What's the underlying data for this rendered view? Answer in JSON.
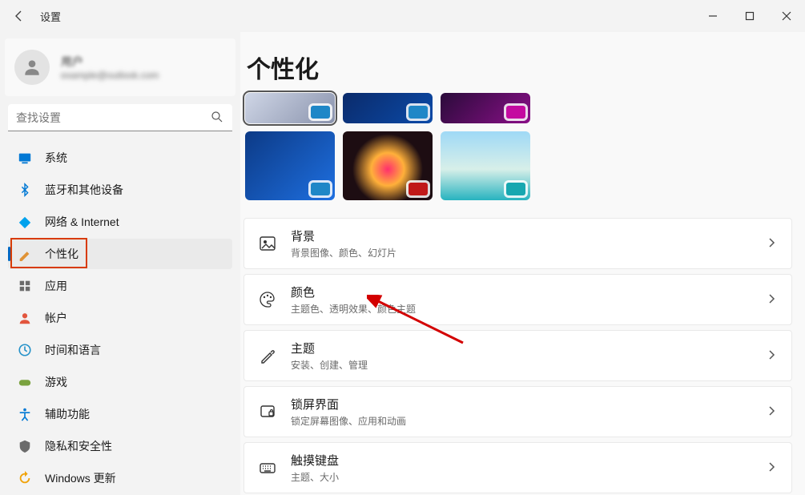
{
  "window": {
    "title": "设置"
  },
  "user": {
    "name": "用户",
    "email": "example@outlook.com"
  },
  "search": {
    "placeholder": "查找设置"
  },
  "sidebar": {
    "items": [
      {
        "label": "系统",
        "icon": "system",
        "color": "#0078d4"
      },
      {
        "label": "蓝牙和其他设备",
        "icon": "bluetooth",
        "color": "#0078d4"
      },
      {
        "label": "网络 & Internet",
        "icon": "wifi",
        "color": "#00a2ed"
      },
      {
        "label": "个性化",
        "icon": "brush",
        "color": "#e09336",
        "active": true
      },
      {
        "label": "应用",
        "icon": "apps",
        "color": "#6b6b6b"
      },
      {
        "label": "帐户",
        "icon": "account",
        "color": "#e2553d"
      },
      {
        "label": "时间和语言",
        "icon": "time",
        "color": "#2592c9"
      },
      {
        "label": "游戏",
        "icon": "gaming",
        "color": "#7aa23f"
      },
      {
        "label": "辅助功能",
        "icon": "accessibility",
        "color": "#0078d4"
      },
      {
        "label": "隐私和安全性",
        "icon": "privacy",
        "color": "#6b6b6b"
      },
      {
        "label": "Windows 更新",
        "icon": "update",
        "color": "#f0a30a"
      }
    ]
  },
  "page": {
    "title": "个性化"
  },
  "theme_presets": [
    {
      "bg": "linear-gradient(135deg,#cfd6e6,#8a93ad)",
      "chip": "#1f87c7",
      "selected": true,
      "short": true
    },
    {
      "bg": "linear-gradient(135deg,#0b2b6b,#0b4aa8)",
      "chip": "#1f87c7",
      "short": true
    },
    {
      "bg": "linear-gradient(135deg,#2a0b3a,#8a0f88)",
      "chip": "#c40aa0",
      "short": true
    },
    {
      "bg": "linear-gradient(135deg,#0c3a86,#1e6fe0)",
      "chip": "#1f87c7"
    },
    {
      "bg": "radial-gradient(circle at 50% 55%,#ff2f6d 0%,#ffb03a 28%,#1d0d12 60%)",
      "chip": "#c01818"
    },
    {
      "bg": "linear-gradient(180deg,#9fd9f6 0%,#d7efe9 55%,#27b3bf 100%)",
      "chip": "#17a7b0"
    }
  ],
  "settings_rows": [
    {
      "icon": "image",
      "title": "背景",
      "subtitle": "背景图像、颜色、幻灯片"
    },
    {
      "icon": "palette",
      "title": "颜色",
      "subtitle": "主题色、透明效果、颜色主题"
    },
    {
      "icon": "brush2",
      "title": "主题",
      "subtitle": "安装、创建、管理"
    },
    {
      "icon": "lockscreen",
      "title": "锁屏界面",
      "subtitle": "锁定屏幕图像、应用和动画"
    },
    {
      "icon": "keyboard",
      "title": "触摸键盘",
      "subtitle": "主题、大小"
    }
  ]
}
